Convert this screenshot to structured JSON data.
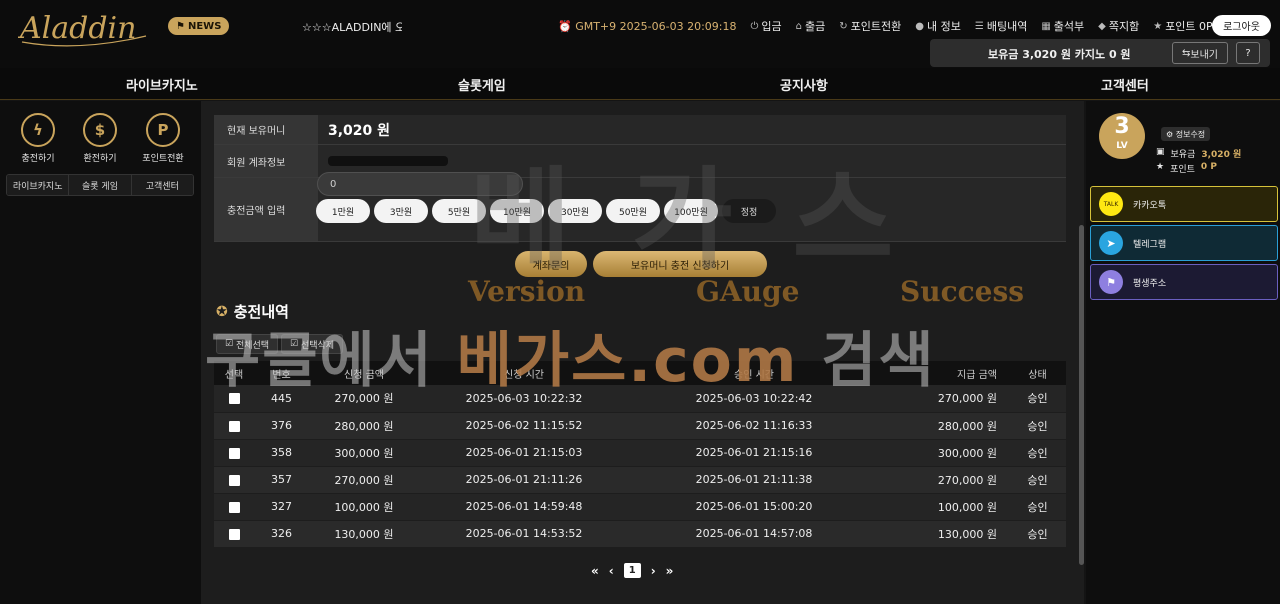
{
  "header": {
    "logo_text": "Aladdin",
    "news_label": "NEWS",
    "marquee_text": "☆☆☆ALADDIN에 오신",
    "clock": "GMT+9 2025-06-03 20:09:18",
    "menu": [
      {
        "icon": "deposit-icon",
        "label": "입금"
      },
      {
        "icon": "withdraw-icon",
        "label": "출금"
      },
      {
        "icon": "point-convert-icon",
        "label": "포인트전환"
      },
      {
        "icon": "user-info-icon",
        "label": "내 정보"
      },
      {
        "icon": "bet-history-icon",
        "label": "배팅내역"
      },
      {
        "icon": "attendance-icon",
        "label": "출석부"
      },
      {
        "icon": "coupon-icon",
        "label": "쪽지함"
      },
      {
        "icon": "point-icon",
        "label": "포인트 0P"
      }
    ],
    "logout_label": "로그아웃",
    "wallet_text": "보유금 3,020 원  카지노 0 원",
    "send_label": "보내기",
    "help_label": "?"
  },
  "nav": {
    "items": [
      "라이브카지노",
      "슬롯게임",
      "공지사항",
      "고객센터"
    ]
  },
  "sidebar": {
    "actions": [
      {
        "icon": "lightning-icon",
        "glyph": "ϟ",
        "label": "충전하기"
      },
      {
        "icon": "dollar-icon",
        "glyph": "$",
        "label": "환전하기"
      },
      {
        "icon": "point-icon",
        "glyph": "P",
        "label": "포인트전환"
      }
    ],
    "tabs": [
      "라이브카지노",
      "슬롯 게임",
      "고객센터"
    ]
  },
  "deposit": {
    "balance_label": "현재 보유머니",
    "balance_value": "3,020 원",
    "account_label": "회원 계좌정보",
    "amount_label": "충전금액 입력",
    "amount_value": "0",
    "amount_buttons": [
      "1만원",
      "3만원",
      "5만원",
      "10만원",
      "30만원",
      "50만원",
      "100만원",
      "정정"
    ],
    "account_inquiry_label": "계좌문의",
    "apply_label": "보유머니 충전 신청하기"
  },
  "history": {
    "title": "충전내역",
    "select_all_label": "전체선택",
    "delete_selected_label": "선택삭제",
    "columns": [
      "선택",
      "번호",
      "신청 금액",
      "신청 시간",
      "승인 시간",
      "지급 금액",
      "상태"
    ],
    "rows": [
      {
        "no": "445",
        "amount": "270,000 원",
        "requested": "2025-06-03 10:22:32",
        "approved": "2025-06-03 10:22:42",
        "paid": "270,000 원",
        "status": "승인"
      },
      {
        "no": "376",
        "amount": "280,000 원",
        "requested": "2025-06-02 11:15:52",
        "approved": "2025-06-02 11:16:33",
        "paid": "280,000 원",
        "status": "승인"
      },
      {
        "no": "358",
        "amount": "300,000 원",
        "requested": "2025-06-01 21:15:03",
        "approved": "2025-06-01 21:15:16",
        "paid": "300,000 원",
        "status": "승인"
      },
      {
        "no": "357",
        "amount": "270,000 원",
        "requested": "2025-06-01 21:11:26",
        "approved": "2025-06-01 21:11:38",
        "paid": "270,000 원",
        "status": "승인"
      },
      {
        "no": "327",
        "amount": "100,000 원",
        "requested": "2025-06-01 14:59:48",
        "approved": "2025-06-01 15:00:20",
        "paid": "100,000 원",
        "status": "승인"
      },
      {
        "no": "326",
        "amount": "130,000 원",
        "requested": "2025-06-01 14:53:52",
        "approved": "2025-06-01 14:57:08",
        "paid": "130,000 원",
        "status": "승인"
      }
    ],
    "pager": {
      "first": "«",
      "prev": "‹",
      "current": "1",
      "next": "›",
      "last": "»"
    }
  },
  "profile": {
    "level_number": "3",
    "level_label": "LV",
    "edit_label": "정보수정",
    "balance_label": "보유금",
    "balance_value": "3,020 원",
    "point_label": "포인트",
    "point_value": "0 P"
  },
  "links": [
    {
      "icon": "kakao-icon",
      "label": "카카오톡",
      "bg": "#2a2508",
      "border": "#d6c23a",
      "icon_bg": "#ffe812"
    },
    {
      "icon": "telegram-icon",
      "label": "텔레그램",
      "bg": "#0f2a35",
      "border": "#2a9fd6",
      "icon_bg": "#2aa5e0"
    },
    {
      "icon": "flag-icon",
      "label": "평생주소",
      "bg": "#1c1a33",
      "border": "#6a5fc0",
      "icon_bg": "#8e7fe0"
    }
  ],
  "watermark": {
    "big": "베가스",
    "search_prefix": "구글에서 ",
    "search_domain": "베가스.com",
    "search_suffix": " 검색",
    "sub": [
      "Version",
      "GAuge",
      "Success"
    ]
  },
  "colors": {
    "accent": "#c9a45c",
    "bg": "#141414"
  }
}
